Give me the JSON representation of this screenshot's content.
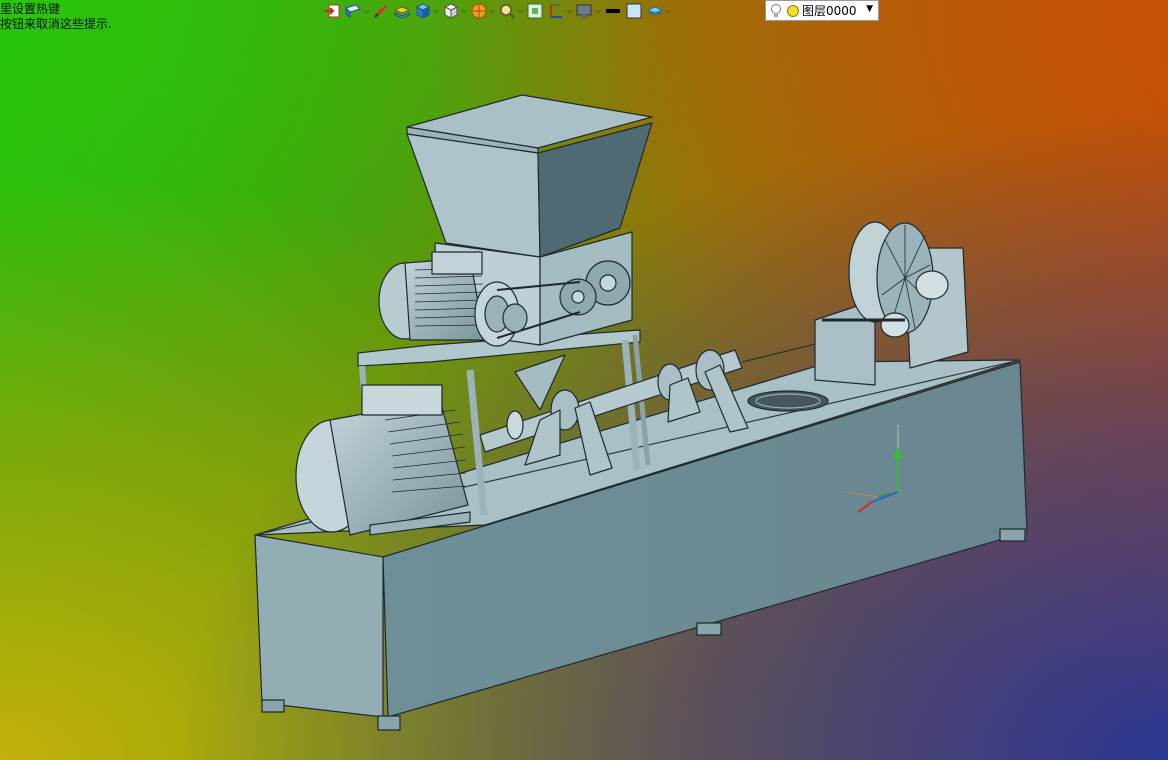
{
  "hints": {
    "line1": "里设置热键",
    "line2": "按钮来取消这些提示."
  },
  "toolbar": {
    "items": [
      {
        "icon": "import-icon",
        "dropdown": false
      },
      {
        "icon": "open-file-icon",
        "dropdown": true
      },
      {
        "icon": "pen-edit-icon",
        "dropdown": false
      },
      {
        "icon": "stack-blocks-icon",
        "dropdown": false
      },
      {
        "icon": "cube-blue-icon",
        "dropdown": true
      },
      {
        "icon": "cube-white-icon",
        "dropdown": true
      },
      {
        "icon": "color-wheel-icon",
        "dropdown": true
      },
      {
        "icon": "zoom-icon",
        "dropdown": true
      },
      {
        "icon": "fit-view-icon",
        "dropdown": false
      },
      {
        "icon": "ruler-icon",
        "dropdown": true
      },
      {
        "icon": "monitor-icon",
        "dropdown": true
      },
      {
        "icon": "line-color-icon",
        "dropdown": false
      },
      {
        "icon": "fill-color-icon",
        "dropdown": false
      },
      {
        "icon": "layers-icon",
        "dropdown": true
      }
    ]
  },
  "layer_select": {
    "value": "图层0000"
  },
  "colors": {
    "model_base": "#9fb6bd",
    "model_dark": "#5d7880",
    "model_edge": "#1e2a2e"
  }
}
